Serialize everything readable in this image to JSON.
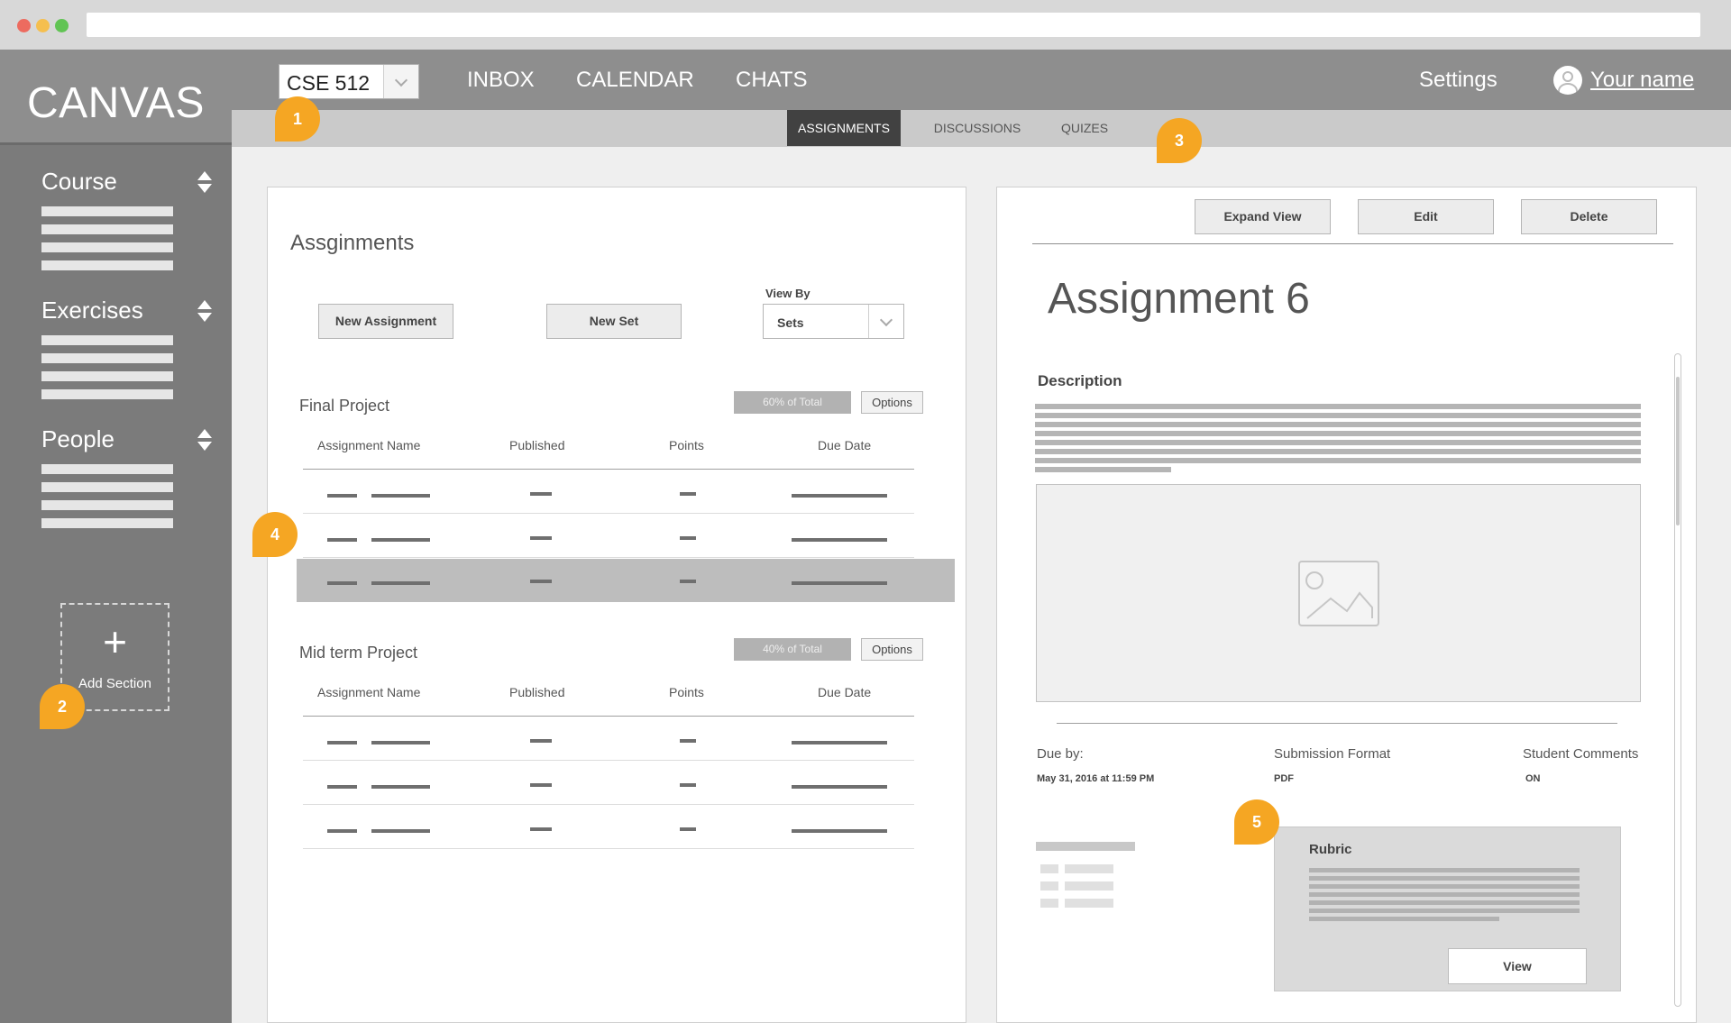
{
  "app": {
    "logo": "CANVAS"
  },
  "topnav": {
    "course": "CSE 512",
    "links": [
      "INBOX",
      "CALENDAR",
      "CHATS"
    ],
    "settings": "Settings",
    "username": "Your name"
  },
  "subnav": {
    "tabs": [
      "ASSIGNMENTS",
      "DISCUSSIONS",
      "QUIZES"
    ],
    "active": "ASSIGNMENTS"
  },
  "sidebar": {
    "sections": [
      {
        "title": "Course",
        "icon": "sort-icon"
      },
      {
        "title": "Exercises",
        "icon": "sort-icon"
      },
      {
        "title": "People",
        "icon": "sort-icon"
      }
    ],
    "add_plus": "+",
    "add_label": "Add Section"
  },
  "assignments": {
    "title": "Assginments",
    "new_assignment": "New Assignment",
    "new_set": "New Set",
    "view_by_label": "View By",
    "view_by_value": "Sets",
    "groups": [
      {
        "title": "Final Project",
        "percent": "60% of Total",
        "options": "Options",
        "columns": [
          "Assignment Name",
          "Published",
          "Points",
          "Due Date"
        ],
        "selected_row": 2
      },
      {
        "title": "Mid term Project",
        "percent": "40% of Total",
        "options": "Options",
        "columns": [
          "Assignment Name",
          "Published",
          "Points",
          "Due Date"
        ]
      }
    ]
  },
  "detail": {
    "expand": "Expand View",
    "edit": "Edit",
    "delete": "Delete",
    "title": "Assignment 6",
    "description_label": "Description",
    "due_label": "Due by:",
    "due_value": "May 31, 2016  at 11:59 PM",
    "format_label": "Submission Format",
    "format_value": "PDF",
    "comments_label": "Student Comments",
    "comments_value": "ON",
    "rubric_title": "Rubric",
    "view_button": "View"
  },
  "markers": [
    "1",
    "2",
    "3",
    "4",
    "5"
  ],
  "colors": {
    "marker": "#f5a623",
    "sidebar": "#7b7b7b",
    "topnav": "#8e8e8e",
    "active_tab": "#414141"
  }
}
